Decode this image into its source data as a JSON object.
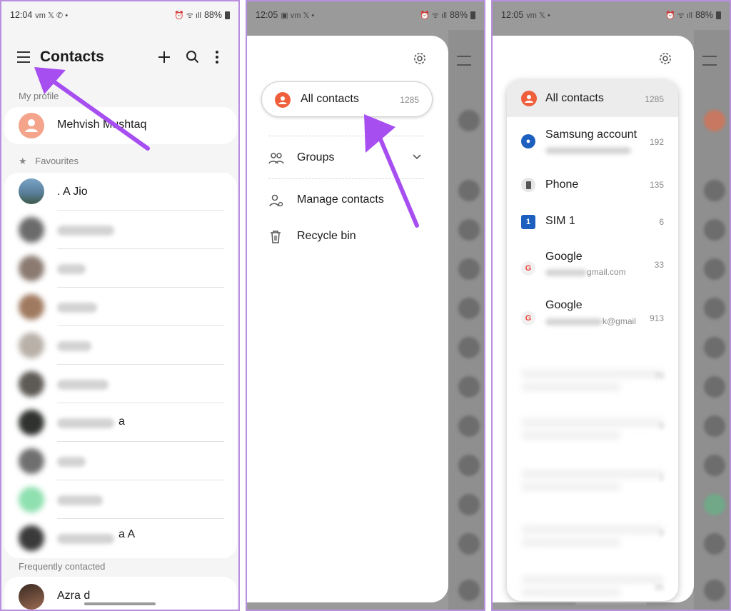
{
  "screen1": {
    "status": {
      "time": "12:04",
      "battery": "88%"
    },
    "title": "Contacts",
    "my_profile_label": "My profile",
    "profile_name": "Mehvish Mushtaq",
    "favourites_label": "Favourites",
    "favourites": [
      ". A Jio",
      "a",
      "a A"
    ],
    "frequently_label": "Frequently contacted",
    "frequent": [
      "Azra d"
    ]
  },
  "screen2": {
    "status": {
      "time": "12:05",
      "battery": "88%"
    },
    "all_contacts": {
      "label": "All contacts",
      "count": "1285"
    },
    "menu": [
      {
        "label": "Groups",
        "icon": "groups-icon"
      },
      {
        "label": "Manage contacts",
        "icon": "manage-contacts-icon"
      },
      {
        "label": "Recycle bin",
        "icon": "trash-icon"
      }
    ]
  },
  "screen3": {
    "status": {
      "time": "12:05",
      "battery": "88%"
    },
    "accounts": [
      {
        "label": "All contacts",
        "count": "1285",
        "sub": ""
      },
      {
        "label": "Samsung account",
        "count": "192",
        "sub": ""
      },
      {
        "label": "Phone",
        "count": "135",
        "sub": ""
      },
      {
        "label": "SIM 1",
        "count": "6",
        "sub": ""
      },
      {
        "label": "Google",
        "count": "33",
        "sub": "gmail.com"
      },
      {
        "label": "Google",
        "count": "913",
        "sub": "k@gmail"
      }
    ],
    "hidden_counts": [
      "70",
      "0",
      "1",
      "0",
      "35"
    ]
  },
  "colors": {
    "accent": "#f05f3c",
    "annotation_arrow": "#a64ef0",
    "panel_border": "#b98fe0"
  }
}
